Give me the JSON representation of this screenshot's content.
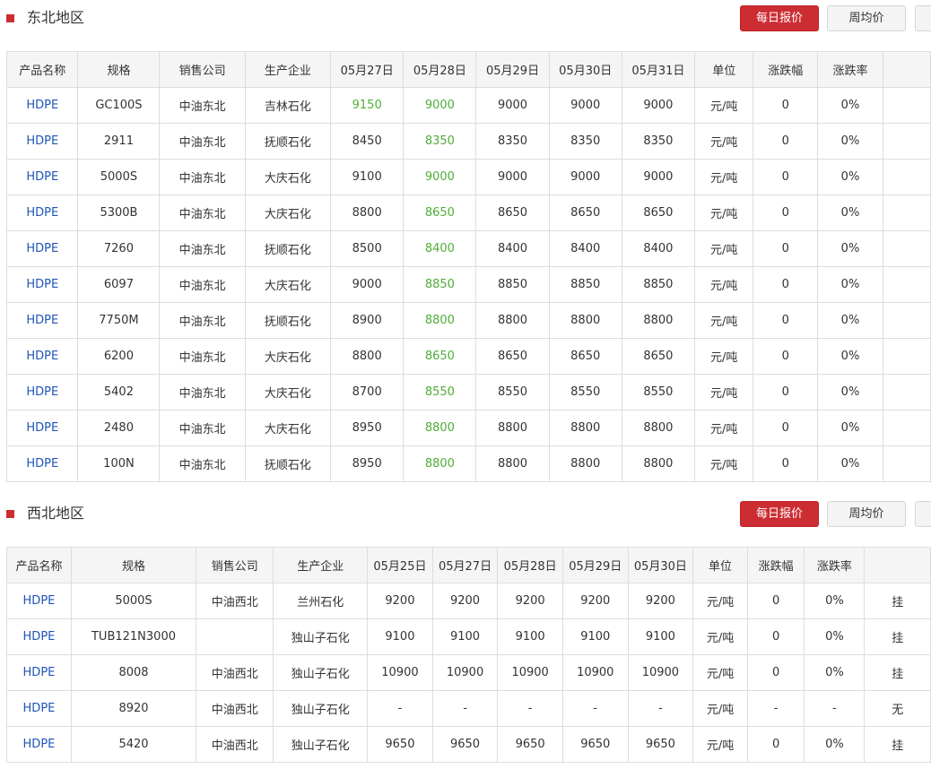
{
  "sections": [
    {
      "title": "东北地区",
      "buttons": {
        "daily": "每日报价",
        "weekly": "周均价",
        "more": ""
      },
      "headers": [
        "产品名称",
        "规格",
        "销售公司",
        "生产企业",
        "05月27日",
        "05月28日",
        "05月29日",
        "05月30日",
        "05月31日",
        "单位",
        "涨跌幅",
        "涨跌率",
        ""
      ],
      "rows": [
        {
          "product": "HDPE",
          "spec": "GC100S",
          "seller": "中油东北",
          "producer": "吉林石化",
          "p1": "9150",
          "p2": "9000",
          "p3": "9000",
          "p4": "9000",
          "p5": "9000",
          "unit": "元/吨",
          "change": "0",
          "rate": "0%",
          "extra": ""
        },
        {
          "product": "HDPE",
          "spec": "2911",
          "seller": "中油东北",
          "producer": "抚顺石化",
          "p1": "8450",
          "p2": "8350",
          "p3": "8350",
          "p4": "8350",
          "p5": "8350",
          "unit": "元/吨",
          "change": "0",
          "rate": "0%",
          "extra": ""
        },
        {
          "product": "HDPE",
          "spec": "5000S",
          "seller": "中油东北",
          "producer": "大庆石化",
          "p1": "9100",
          "p2": "9000",
          "p3": "9000",
          "p4": "9000",
          "p5": "9000",
          "unit": "元/吨",
          "change": "0",
          "rate": "0%",
          "extra": ""
        },
        {
          "product": "HDPE",
          "spec": "5300B",
          "seller": "中油东北",
          "producer": "大庆石化",
          "p1": "8800",
          "p2": "8650",
          "p3": "8650",
          "p4": "8650",
          "p5": "8650",
          "unit": "元/吨",
          "change": "0",
          "rate": "0%",
          "extra": ""
        },
        {
          "product": "HDPE",
          "spec": "7260",
          "seller": "中油东北",
          "producer": "抚顺石化",
          "p1": "8500",
          "p2": "8400",
          "p3": "8400",
          "p4": "8400",
          "p5": "8400",
          "unit": "元/吨",
          "change": "0",
          "rate": "0%",
          "extra": ""
        },
        {
          "product": "HDPE",
          "spec": "6097",
          "seller": "中油东北",
          "producer": "大庆石化",
          "p1": "9000",
          "p2": "8850",
          "p3": "8850",
          "p4": "8850",
          "p5": "8850",
          "unit": "元/吨",
          "change": "0",
          "rate": "0%",
          "extra": ""
        },
        {
          "product": "HDPE",
          "spec": "7750M",
          "seller": "中油东北",
          "producer": "抚顺石化",
          "p1": "8900",
          "p2": "8800",
          "p3": "8800",
          "p4": "8800",
          "p5": "8800",
          "unit": "元/吨",
          "change": "0",
          "rate": "0%",
          "extra": ""
        },
        {
          "product": "HDPE",
          "spec": "6200",
          "seller": "中油东北",
          "producer": "大庆石化",
          "p1": "8800",
          "p2": "8650",
          "p3": "8650",
          "p4": "8650",
          "p5": "8650",
          "unit": "元/吨",
          "change": "0",
          "rate": "0%",
          "extra": ""
        },
        {
          "product": "HDPE",
          "spec": "5402",
          "seller": "中油东北",
          "producer": "大庆石化",
          "p1": "8700",
          "p2": "8550",
          "p3": "8550",
          "p4": "8550",
          "p5": "8550",
          "unit": "元/吨",
          "change": "0",
          "rate": "0%",
          "extra": ""
        },
        {
          "product": "HDPE",
          "spec": "2480",
          "seller": "中油东北",
          "producer": "大庆石化",
          "p1": "8950",
          "p2": "8800",
          "p3": "8800",
          "p4": "8800",
          "p5": "8800",
          "unit": "元/吨",
          "change": "0",
          "rate": "0%",
          "extra": ""
        },
        {
          "product": "HDPE",
          "spec": "100N",
          "seller": "中油东北",
          "producer": "抚顺石化",
          "p1": "8950",
          "p2": "8800",
          "p3": "8800",
          "p4": "8800",
          "p5": "8800",
          "unit": "元/吨",
          "change": "0",
          "rate": "0%",
          "extra": ""
        }
      ]
    },
    {
      "title": "西北地区",
      "buttons": {
        "daily": "每日报价",
        "weekly": "周均价",
        "more": ""
      },
      "headers": [
        "产品名称",
        "规格",
        "销售公司",
        "生产企业",
        "05月25日",
        "05月27日",
        "05月28日",
        "05月29日",
        "05月30日",
        "单位",
        "涨跌幅",
        "涨跌率",
        ""
      ],
      "rows": [
        {
          "product": "HDPE",
          "spec": "5000S",
          "seller": "中油西北",
          "producer": "兰州石化",
          "p1": "9200",
          "p2": "9200",
          "p3": "9200",
          "p4": "9200",
          "p5": "9200",
          "unit": "元/吨",
          "change": "0",
          "rate": "0%",
          "extra": "挂"
        },
        {
          "product": "HDPE",
          "spec": "TUB121N3000",
          "seller": "",
          "producer": "独山子石化",
          "p1": "9100",
          "p2": "9100",
          "p3": "9100",
          "p4": "9100",
          "p5": "9100",
          "unit": "元/吨",
          "change": "0",
          "rate": "0%",
          "extra": "挂"
        },
        {
          "product": "HDPE",
          "spec": "8008",
          "seller": "中油西北",
          "producer": "独山子石化",
          "p1": "10900",
          "p2": "10900",
          "p3": "10900",
          "p4": "10900",
          "p5": "10900",
          "unit": "元/吨",
          "change": "0",
          "rate": "0%",
          "extra": "挂"
        },
        {
          "product": "HDPE",
          "spec": "8920",
          "seller": "中油西北",
          "producer": "独山子石化",
          "p1": "-",
          "p2": "-",
          "p3": "-",
          "p4": "-",
          "p5": "-",
          "unit": "元/吨",
          "change": "-",
          "rate": "-",
          "extra": "无"
        },
        {
          "product": "HDPE",
          "spec": "5420",
          "seller": "中油西北",
          "producer": "独山子石化",
          "p1": "9650",
          "p2": "9650",
          "p3": "9650",
          "p4": "9650",
          "p5": "9650",
          "unit": "元/吨",
          "change": "0",
          "rate": "0%",
          "extra": "挂"
        }
      ]
    }
  ],
  "colors": {
    "accent": "#cc2d33",
    "link": "#1f55b8",
    "down": "#4fad38"
  }
}
